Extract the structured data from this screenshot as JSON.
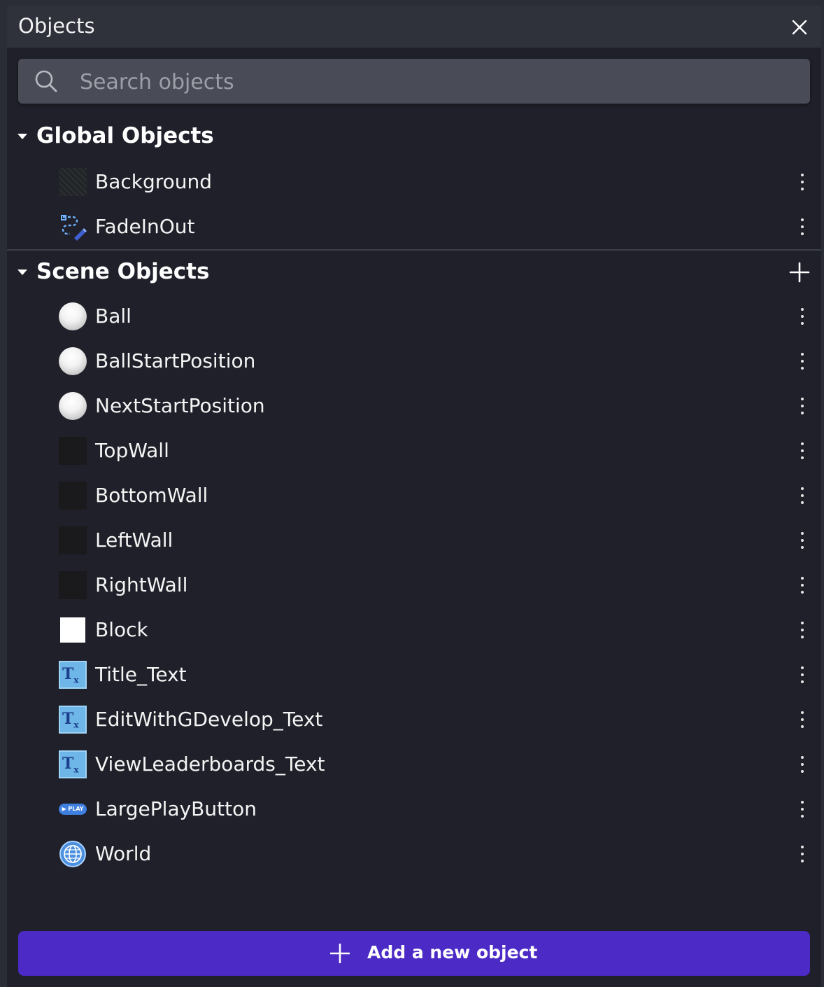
{
  "panel": {
    "title": "Objects",
    "close_icon": "close-icon"
  },
  "search": {
    "placeholder": "Search objects",
    "value": "",
    "icon": "search-icon"
  },
  "global_objects": {
    "label": "Global Objects",
    "expanded": true,
    "items": [
      {
        "name": "Background",
        "icon": "tiled-texture-thumbnail"
      },
      {
        "name": "FadeInOut",
        "icon": "object-extension-icon"
      }
    ]
  },
  "scene_objects": {
    "label": "Scene Objects",
    "expanded": true,
    "add_icon": "plus-icon",
    "items": [
      {
        "name": "Ball",
        "icon": "sphere-thumbnail"
      },
      {
        "name": "BallStartPosition",
        "icon": "sphere-thumbnail"
      },
      {
        "name": "NextStartPosition",
        "icon": "sphere-thumbnail"
      },
      {
        "name": "TopWall",
        "icon": "dark-square-thumbnail"
      },
      {
        "name": "BottomWall",
        "icon": "dark-square-thumbnail"
      },
      {
        "name": "LeftWall",
        "icon": "dark-square-thumbnail"
      },
      {
        "name": "RightWall",
        "icon": "dark-square-thumbnail"
      },
      {
        "name": "Block",
        "icon": "white-square-thumbnail"
      },
      {
        "name": "Title_Text",
        "icon": "text-object-icon"
      },
      {
        "name": "EditWithGDevelop_Text",
        "icon": "text-object-icon"
      },
      {
        "name": "ViewLeaderboards_Text",
        "icon": "text-object-icon"
      },
      {
        "name": "LargePlayButton",
        "icon": "play-button-thumbnail"
      },
      {
        "name": "World",
        "icon": "globe-icon"
      }
    ]
  },
  "thumb_text": {
    "text_icon_glyph": "T",
    "text_icon_sub": "x",
    "play_label": "▶ PLAY"
  },
  "footer": {
    "add_button_label": "Add a new object"
  },
  "colors": {
    "panel_bg": "#1f2029",
    "titlebar_bg": "#2f313b",
    "search_bg": "#494b56",
    "accent": "#4c2ac6"
  }
}
